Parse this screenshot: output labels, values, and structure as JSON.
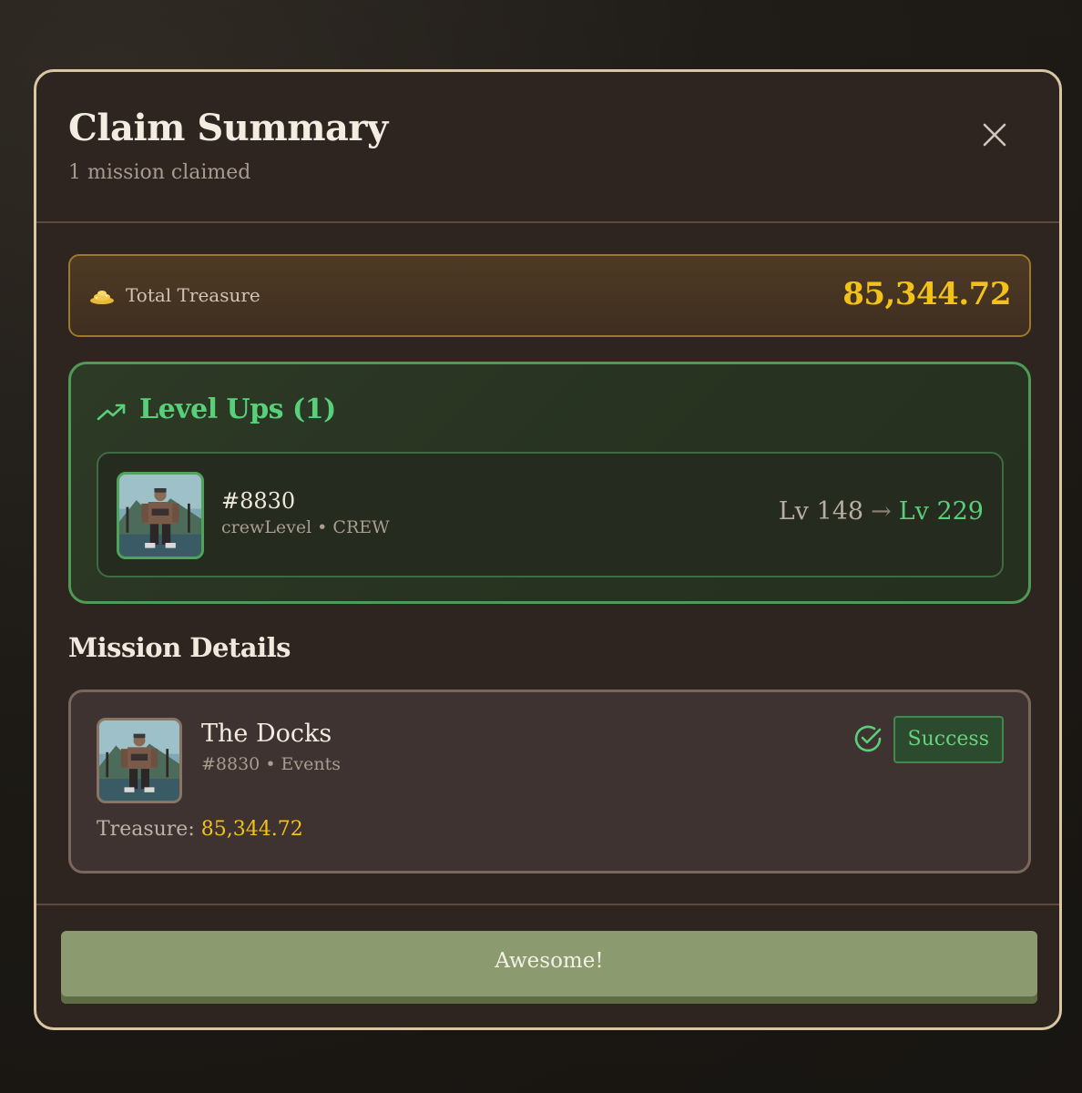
{
  "modal": {
    "title": "Claim Summary",
    "subtitle": "1 mission claimed"
  },
  "treasure": {
    "icon": "gold-pile-icon",
    "label": "Total Treasure",
    "value": "85,344.72"
  },
  "level_ups": {
    "icon": "trending-up-icon",
    "title": "Level Ups (1)",
    "items": [
      {
        "id": "#8830",
        "subtitle": "crewLevel • CREW",
        "from": "Lv 148",
        "arrow": "→",
        "to": "Lv 229"
      }
    ]
  },
  "mission_details": {
    "title": "Mission Details",
    "missions": [
      {
        "name": "The Docks",
        "subtitle": "#8830 • Events",
        "status": "Success",
        "treasure_label": "Treasure:",
        "treasure_value": "85,344.72"
      }
    ]
  },
  "footer": {
    "button_label": "Awesome!"
  },
  "colors": {
    "gold": "#f2c21b",
    "green": "#58d07a",
    "border_accent": "#d9c7a4",
    "button": "#8c9a70"
  }
}
